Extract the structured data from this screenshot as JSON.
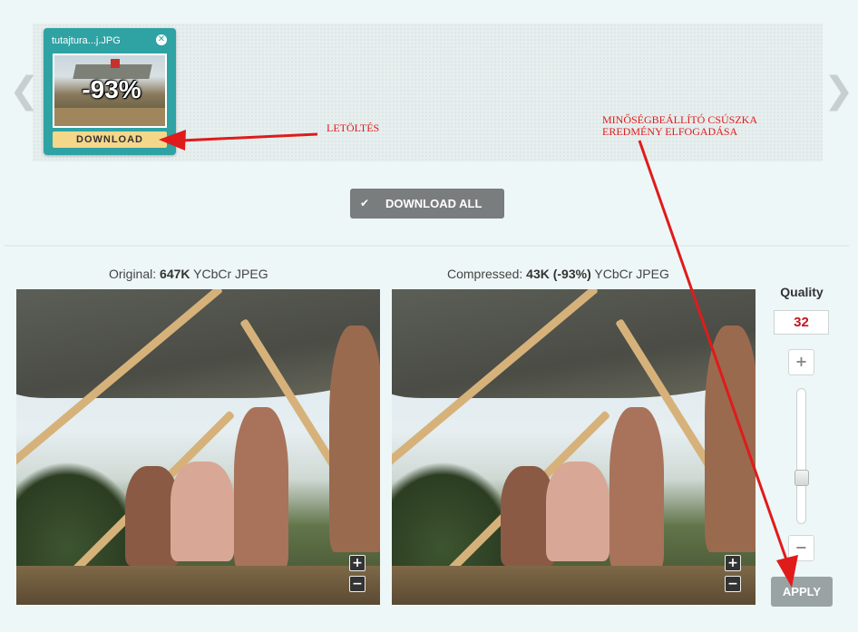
{
  "carousel": {
    "prev_glyph": "❮",
    "next_glyph": "❯",
    "file": {
      "name": "tutajtura...j.JPG",
      "close_glyph": "✕",
      "percent": "-93%",
      "download_label": "DOWNLOAD"
    }
  },
  "download_all": {
    "check_glyph": "✔",
    "label": "DOWNLOAD ALL"
  },
  "annotations": {
    "download": "LETÖLTÉS",
    "quality_line1": "MINŐSÉGBEÁLLÍTÓ CSÚSZKA",
    "quality_line2": "EREDMÉNY ELFOGADÁSA",
    "arrow_color": "#e01b1b"
  },
  "compare": {
    "original": {
      "prefix": "Original: ",
      "size": "647K",
      "suffix": " YCbCr JPEG"
    },
    "compressed": {
      "prefix": "Compressed: ",
      "size": "43K (-93%)",
      "suffix": " YCbCr JPEG"
    },
    "zoom_in_glyph": "+",
    "zoom_out_glyph": "−"
  },
  "quality": {
    "title": "Quality",
    "value": "32",
    "plus_glyph": "+",
    "minus_glyph": "−",
    "level_fraction": 0.32,
    "apply_label": "APPLY"
  },
  "icons": {
    "prev": "chevron-left-icon",
    "next": "chevron-right-icon",
    "close": "close-icon",
    "check": "check-icon",
    "zoom_in": "plus-icon",
    "zoom_out": "minus-icon"
  },
  "colors": {
    "accent": "#2fa2a4",
    "download_button": "#f5d78a",
    "quality_value": "#c4161c",
    "background": "#eef7f7"
  }
}
